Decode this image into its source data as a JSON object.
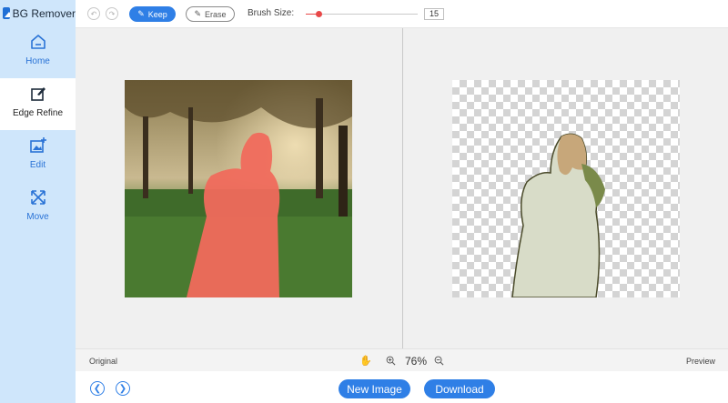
{
  "app": {
    "title": "BG Remover"
  },
  "sidebar": {
    "items": [
      {
        "label": "Home",
        "icon": "home-icon"
      },
      {
        "label": "Edge Refine",
        "icon": "edge-refine-icon",
        "active": true
      },
      {
        "label": "Edit",
        "icon": "edit-image-icon"
      },
      {
        "label": "Move",
        "icon": "move-icon"
      }
    ]
  },
  "toolbar": {
    "keep_label": "Keep",
    "erase_label": "Erase",
    "brush_size_label": "Brush Size:",
    "brush_size_value": "15",
    "brush_size_slider_fraction": 0.11
  },
  "status": {
    "original_label": "Original",
    "preview_label": "Preview",
    "zoom_value": "76%"
  },
  "actions": {
    "new_image_label": "New Image",
    "download_label": "Download"
  },
  "colors": {
    "accent": "#2f7fe6",
    "sidebar_bg": "#cfe6fb",
    "brush": "#e84848"
  }
}
